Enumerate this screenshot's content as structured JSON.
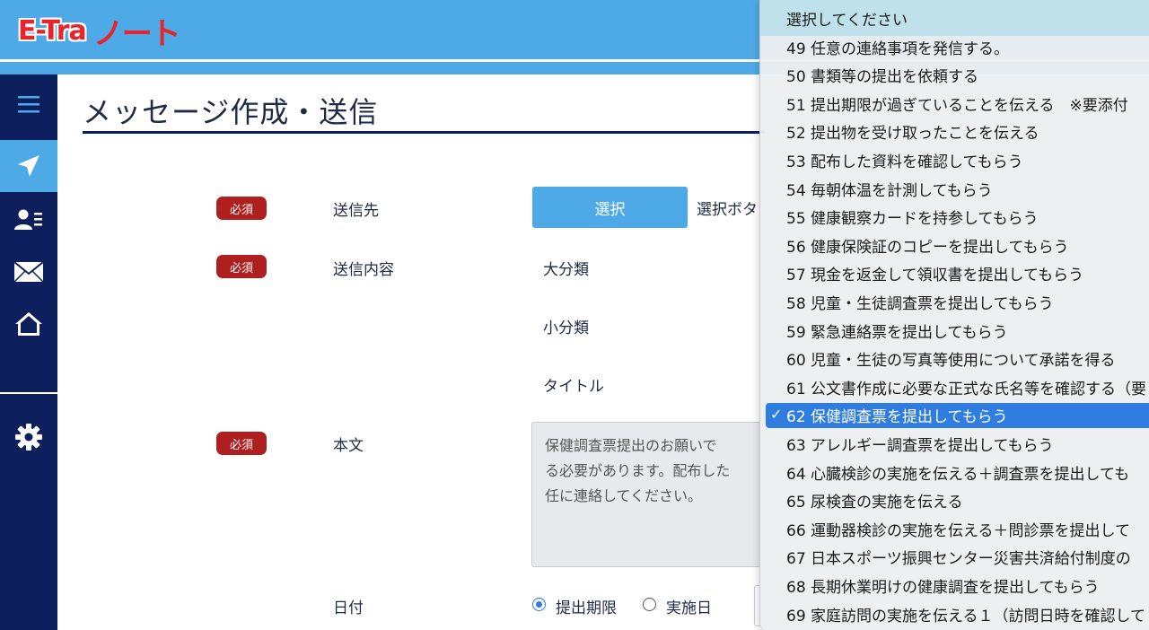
{
  "app": {
    "logo_main": "E-Tra",
    "logo_sub": "ノート"
  },
  "sidebar": {
    "items": [
      {
        "name": "menu",
        "icon": "menu-icon"
      },
      {
        "name": "send",
        "icon": "paper-plane-icon",
        "active": true
      },
      {
        "name": "contacts",
        "icon": "contact-card-icon"
      },
      {
        "name": "mail",
        "icon": "envelope-icon"
      },
      {
        "name": "home",
        "icon": "home-icon"
      },
      {
        "name": "settings",
        "icon": "gear-icon"
      }
    ]
  },
  "page": {
    "title": "メッセージ作成・送信"
  },
  "form": {
    "required_badge": "必須",
    "recipient_label": "送信先",
    "select_button": "選択",
    "select_hint": "選択ボタ",
    "content_label": "送信内容",
    "major_category": "大分類",
    "minor_category": "小分類",
    "title_label": "タイトル",
    "body_label": "本文",
    "body_text": "保健調査票提出のお願いです る必要があります。配布した 任に連絡してください。",
    "body_line1": "保健調査票提出のお願いで",
    "body_line2": "る必要があります。配布した",
    "body_line3": "任に連絡してください。",
    "date_label": "日付",
    "date_option_deadline": "提出期限",
    "date_option_implementation": "実施日",
    "date_selected": "提出期限"
  },
  "dropdown": {
    "placeholder": "選択してください",
    "options": [
      "49 任意の連絡事項を発信する。",
      "50 書類等の提出を依頼する",
      "51 提出期限が過ぎていることを伝える　※要添付",
      "52 提出物を受け取ったことを伝える",
      "53 配布した資料を確認してもらう",
      "54 毎朝体温を計測してもらう",
      "55 健康観察カードを持参してもらう",
      "56 健康保険証のコピーを提出してもらう",
      "57 現金を返金して領収書を提出してもらう",
      "58 児童・生徒調査票を提出してもらう",
      "59 緊急連絡票を提出してもらう",
      "60 児童・生徒の写真等使用について承諾を得る",
      "61 公文書作成に必要な正式な氏名等を確認する（要",
      "62 保健調査票を提出してもらう",
      "63 アレルギー調査票を提出してもらう",
      "64 心臓検診の実施を伝える＋調査票を提出しても",
      "65 尿検査の実施を伝える",
      "66 運動器検診の実施を伝える＋問診票を提出して",
      "67 日本スポーツ振興センター災害共済給付制度の",
      "68 長期休業明けの健康調査を提出してもらう",
      "69 家庭訪問の実施を伝える１（訪問日時を確認して"
    ],
    "selected": "62 保健調査票を提出してもらう",
    "check_mark": "✓"
  },
  "colors": {
    "header": "#4eaae6",
    "sidebar": "#0d1f5c",
    "badge": "#b01f1f",
    "accent": "#2f7de1",
    "logo": "#e8232b"
  }
}
